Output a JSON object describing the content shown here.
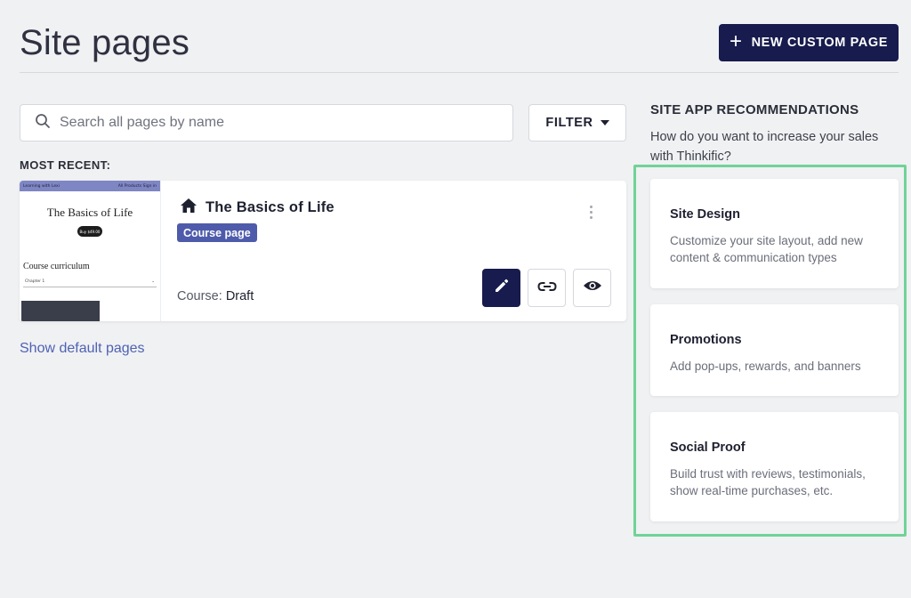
{
  "header": {
    "title": "Site pages",
    "new_page_label": "NEW CUSTOM PAGE"
  },
  "search": {
    "placeholder": "Search all pages by name",
    "value": ""
  },
  "filter": {
    "label": "FILTER"
  },
  "most_recent_label": "MOST RECENT:",
  "page_card": {
    "title": "The Basics of Life",
    "badge": "Course page",
    "status_label": "Course:",
    "status_value": "Draft",
    "thumbnail": {
      "bar_left": "Learning with Lexi",
      "bar_right": "All Products   Sign in",
      "title": "The Basics of Life",
      "button": "Buy $49.00",
      "curriculum": "Course curriculum",
      "chapter": "Chapter 1"
    }
  },
  "show_default_label": "Show default pages",
  "recommendations": {
    "heading": "SITE APP RECOMMENDATIONS",
    "subheading": "How do you want to increase your sales with Thinkific?",
    "items": [
      {
        "title": "Site Design",
        "description": "Customize your site layout, add new content & communication types"
      },
      {
        "title": "Promotions",
        "description": "Add pop-ups, rewards, and banners"
      },
      {
        "title": "Social Proof",
        "description": "Build trust with reviews, testimonials, show real-time purchases, etc."
      }
    ]
  },
  "colors": {
    "primary": "#171b4d",
    "badge": "#4e5bab",
    "link": "#4e62b3",
    "highlight": "#6fd398",
    "background": "#f0f1f3"
  }
}
